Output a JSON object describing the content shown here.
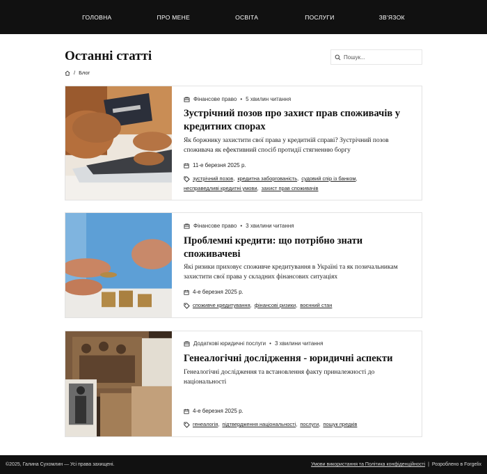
{
  "nav": {
    "items": [
      "ГОЛОВНА",
      "ПРО МЕНЕ",
      "ОСВІТА",
      "ПОСЛУГИ",
      "ЗВ'ЯЗОК"
    ]
  },
  "header": {
    "title": "Останні статті",
    "search_placeholder": "Пошук...",
    "breadcrumb": {
      "home_icon": "home-icon",
      "separator": "/",
      "current": "Блог"
    }
  },
  "articles": [
    {
      "category": "Фінансове право",
      "reading_time": "5 хвилин читання",
      "title": "Зустрічний позов про захист прав споживачів у кредитних спорах",
      "excerpt": "Як боржнику захистити свої права у кредитній справі? Зустрічний позов споживача як ефективний спосіб протидії стягненню боргу",
      "date": "11-е березня 2025 р.",
      "tags": [
        "зустрічний позов",
        "кредитна заборгованість",
        "судовий спір із банком",
        "несправедливі кредитні умови",
        "захист прав споживачів"
      ]
    },
    {
      "category": "Фінансове право",
      "reading_time": "3 хвилини читання",
      "title": "Проблемні кредити: що потрібно знати споживачеві",
      "excerpt": "Які ризики приховує споживче кредитування в Україні та як позичальникам захистити свої права у складних фінансових ситуаціях",
      "date": "4-е березня 2025 р.",
      "tags": [
        "споживче кредитування",
        "фінансові ризики",
        "воєнний стан"
      ]
    },
    {
      "category": "Додаткові юридичні послуги",
      "reading_time": "3 хвилини читання",
      "title": "Генеалогічні дослідження - юридичні аспекти",
      "excerpt": "Генеалогічні дослідження та встановлення факту приналежності до національності",
      "date": "4-е березня 2025 р.",
      "tags": [
        "генеалогія",
        "підтвердження національності",
        "послуги",
        "пошук предків"
      ]
    }
  ],
  "footer": {
    "copyright": "©2025, Галина Сухомлин — Усі права захищені.",
    "terms_link": "Умови використання та Політика конфіденційності",
    "separator": "|",
    "developer": "Розроблено в Forgelix"
  },
  "colors": {
    "nav_bg": "#111111",
    "footer_bg": "#111111",
    "card_border": "#e2e2e2",
    "text": "#111111"
  }
}
